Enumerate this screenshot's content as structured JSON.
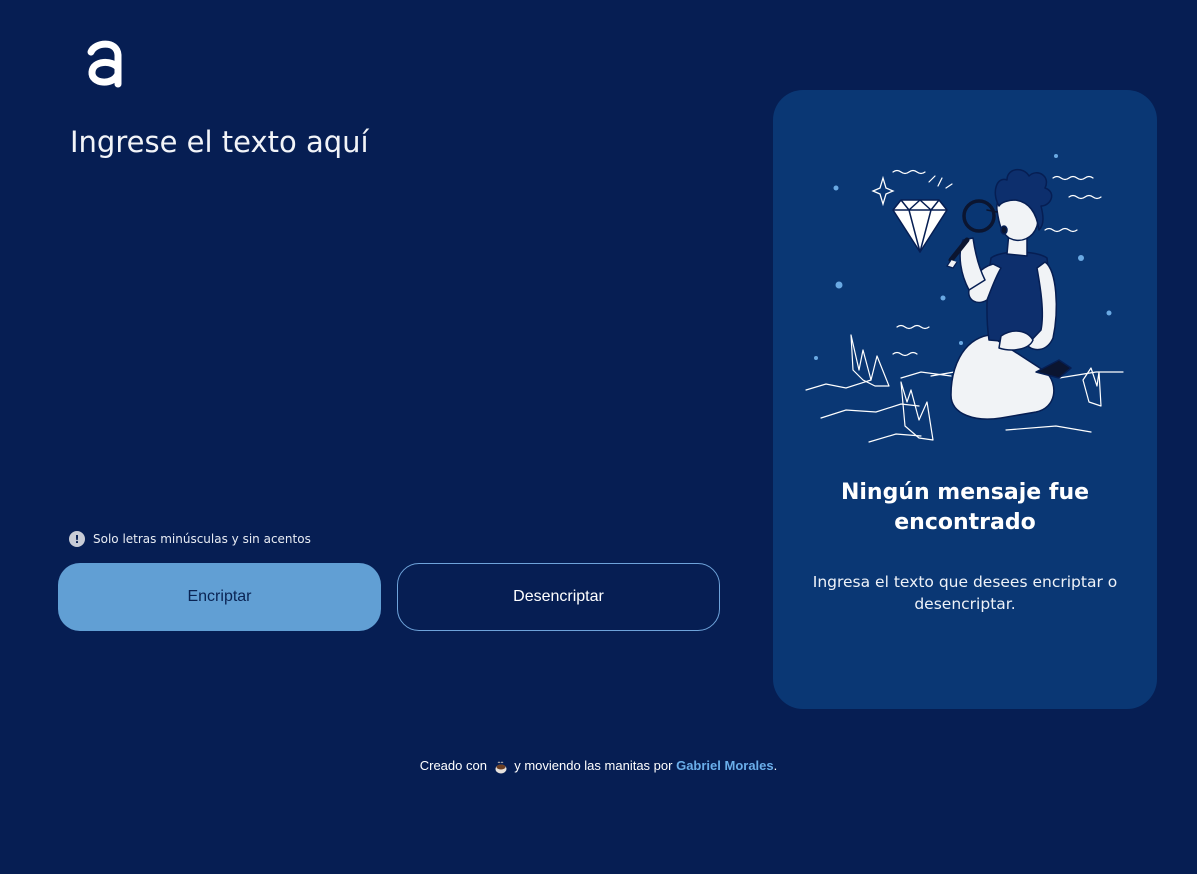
{
  "input": {
    "placeholder": "Ingrese el texto aquí",
    "value": ""
  },
  "hint": {
    "icon": "exclamation-icon",
    "symbol": "!",
    "text": "Solo letras minúsculas y sin acentos"
  },
  "buttons": {
    "encrypt_label": "Encriptar",
    "decrypt_label": "Desencriptar"
  },
  "panel": {
    "title": "Ningún mensaje fue encontrado",
    "text": "Ingresa el texto que desees encriptar o desencriptar."
  },
  "footer": {
    "prefix": "Creado con",
    "middle": "y moviendo las manitas por",
    "author": "Gabriel Morales",
    "suffix": "."
  },
  "colors": {
    "background": "#061e53",
    "panel": "#0a3774",
    "encrypt_button": "#619fd4",
    "link": "#6aaeea"
  }
}
